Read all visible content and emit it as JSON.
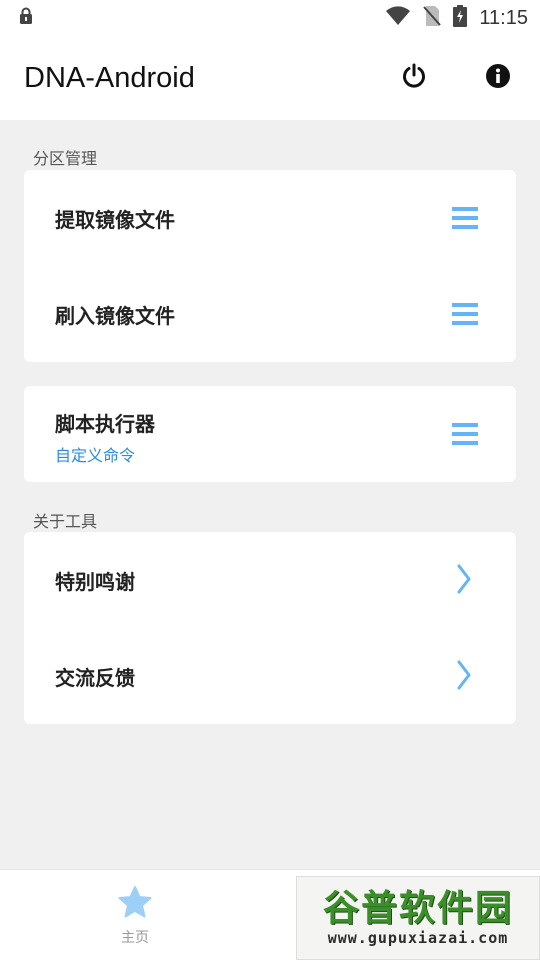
{
  "status_bar": {
    "time": "11:15",
    "icons": [
      "lock-icon",
      "wifi-icon",
      "no-sim-icon",
      "battery-charging-icon"
    ]
  },
  "app_bar": {
    "title": "DNA-Android",
    "actions": [
      "power-icon",
      "info-icon"
    ]
  },
  "sections": {
    "partition": {
      "header": "分区管理",
      "rows": [
        {
          "label": "提取镜像文件",
          "icon": "menu-icon"
        },
        {
          "label": "刷入镜像文件",
          "icon": "menu-icon"
        }
      ]
    },
    "script": {
      "label": "脚本执行器",
      "subtitle": "自定义命令",
      "icon": "menu-icon"
    },
    "about": {
      "header": "关于工具",
      "rows": [
        {
          "label": "特别鸣谢",
          "icon": "chevron-right-icon"
        },
        {
          "label": "交流反馈",
          "icon": "chevron-right-icon"
        }
      ]
    }
  },
  "bottom_nav": {
    "items": [
      {
        "label": "主页",
        "icon": "star-icon"
      }
    ]
  },
  "watermark": {
    "main": "谷普软件园",
    "url": "www.gupuxiazai.com"
  },
  "colors": {
    "accent": "#64b5f6",
    "link": "#2a8ee0",
    "background": "#f0f0f0",
    "card": "#ffffff"
  }
}
